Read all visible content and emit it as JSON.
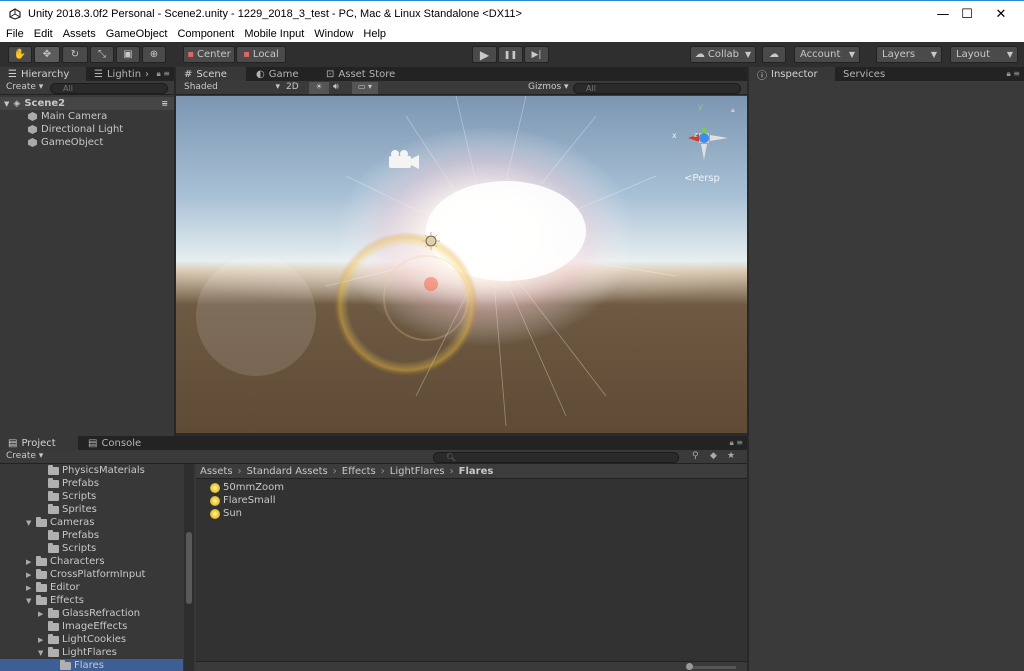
{
  "window": {
    "title": "Unity 2018.3.0f2 Personal - Scene2.unity - 1229_2018_3_test - PC, Mac & Linux Standalone <DX11>",
    "minimize": "—",
    "maximize": "☐",
    "close": "✕"
  },
  "menu": [
    "File",
    "Edit",
    "Assets",
    "GameObject",
    "Component",
    "Mobile Input",
    "Window",
    "Help"
  ],
  "toolbar": {
    "pivot": "Center",
    "space": "Local",
    "play": "▶",
    "pause": "❚❚",
    "step": "▶|",
    "collab": "Collab",
    "account": "Account",
    "layers": "Layers",
    "layout": "Layout"
  },
  "hierarchy": {
    "tabs": [
      "Hierarchy",
      "Lightin"
    ],
    "create": "Create",
    "search_placeholder": "All",
    "scene": "Scene2",
    "items": [
      "Main Camera",
      "Directional Light",
      "GameObject"
    ]
  },
  "scene": {
    "tabs": [
      "Scene",
      "Game",
      "Asset Store"
    ],
    "shading": "Shaded",
    "mode2d": "2D",
    "gizmos": "Gizmos",
    "search_placeholder": "All",
    "persp": "Persp",
    "axis_x": "x",
    "axis_y": "y",
    "axis_z": "z"
  },
  "inspector": {
    "tabs": [
      "Inspector",
      "Services"
    ]
  },
  "project": {
    "tabs": [
      "Project",
      "Console"
    ],
    "create": "Create",
    "breadcrumb": [
      "Assets",
      "Standard Assets",
      "Effects",
      "LightFlares",
      "Flares"
    ],
    "tree": [
      {
        "label": "PhysicsMaterials",
        "depth": 2,
        "arrow": ""
      },
      {
        "label": "Prefabs",
        "depth": 2,
        "arrow": ""
      },
      {
        "label": "Scripts",
        "depth": 2,
        "arrow": ""
      },
      {
        "label": "Sprites",
        "depth": 2,
        "arrow": ""
      },
      {
        "label": "Cameras",
        "depth": 1,
        "arrow": "▼"
      },
      {
        "label": "Prefabs",
        "depth": 2,
        "arrow": ""
      },
      {
        "label": "Scripts",
        "depth": 2,
        "arrow": ""
      },
      {
        "label": "Characters",
        "depth": 1,
        "arrow": "▶"
      },
      {
        "label": "CrossPlatformInput",
        "depth": 1,
        "arrow": "▶"
      },
      {
        "label": "Editor",
        "depth": 1,
        "arrow": "▶"
      },
      {
        "label": "Effects",
        "depth": 1,
        "arrow": "▼"
      },
      {
        "label": "GlassRefraction",
        "depth": 2,
        "arrow": "▶"
      },
      {
        "label": "ImageEffects",
        "depth": 2,
        "arrow": ""
      },
      {
        "label": "LightCookies",
        "depth": 2,
        "arrow": "▶"
      },
      {
        "label": "LightFlares",
        "depth": 2,
        "arrow": "▼"
      },
      {
        "label": "Flares",
        "depth": 3,
        "arrow": ""
      }
    ],
    "assets": [
      "50mmZoom",
      "FlareSmall",
      "Sun"
    ]
  }
}
